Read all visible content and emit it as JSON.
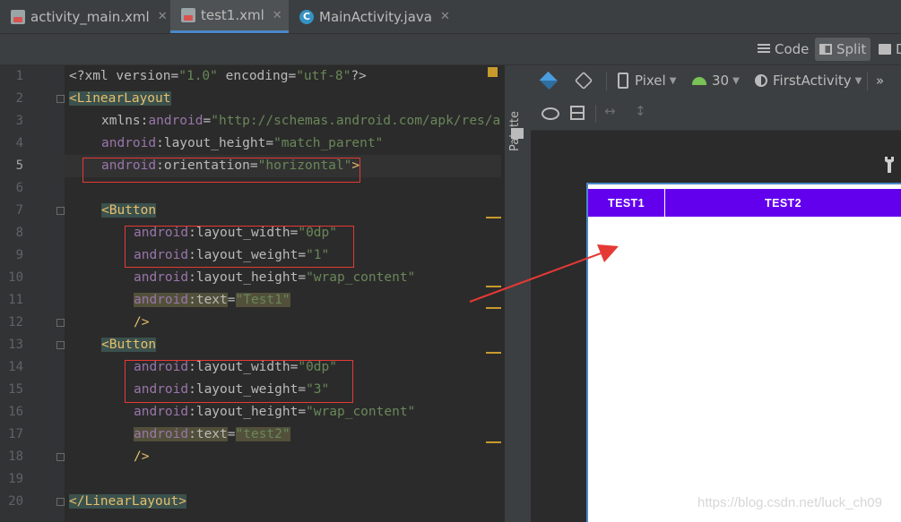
{
  "tabs": [
    {
      "label": "activity_main.xml",
      "icon": "xml-file-icon",
      "active": false
    },
    {
      "label": "test1.xml",
      "icon": "xml-file-icon",
      "active": true
    },
    {
      "label": "MainActivity.java",
      "icon": "java-class-icon",
      "active": false
    }
  ],
  "java_icon_letter": "C",
  "view_modes": {
    "code": "Code",
    "split": "Split",
    "design": "D"
  },
  "palette_label": "Palette",
  "line_numbers": [
    "1",
    "2",
    "3",
    "4",
    "5",
    "6",
    "7",
    "8",
    "9",
    "10",
    "11",
    "12",
    "13",
    "14",
    "15",
    "16",
    "17",
    "18",
    "19",
    "20"
  ],
  "code": {
    "l1": {
      "pi": "<?xml ",
      "a1": "version",
      "eq1": "=",
      "v1": "\"1.0\"",
      "sp": " ",
      "a2": "encoding",
      "eq2": "=",
      "v2": "\"utf-8\"",
      "end": "?>"
    },
    "l2": {
      "tag": "<LinearLayout"
    },
    "l3": {
      "ns": "xmlns:",
      "attr": "android",
      "eq": "=",
      "val": "\"http://schemas.android.com/apk/res/android\""
    },
    "l4": {
      "ns": "android",
      "attr": ":layout_height",
      "eq": "=",
      "val": "\"match_parent\""
    },
    "l5": {
      "ns": "android",
      "attr": ":orientation",
      "eq": "=",
      "val": "\"horizontal\"",
      "end": ">"
    },
    "l7": {
      "tag": "<Button"
    },
    "l8": {
      "ns": "android",
      "attr": ":layout_width",
      "eq": "=",
      "val": "\"0dp\""
    },
    "l9": {
      "ns": "android",
      "attr": ":layout_weight",
      "eq": "=",
      "val": "\"1\""
    },
    "l10": {
      "ns": "android",
      "attr": ":layout_height",
      "eq": "=",
      "val": "\"wrap_content\""
    },
    "l11": {
      "ns": "android",
      "attr": ":text",
      "eq": "=",
      "val": "\"Test1\""
    },
    "l12": {
      "end": "/>"
    },
    "l13": {
      "tag": "<Button"
    },
    "l14": {
      "ns": "android",
      "attr": ":layout_width",
      "eq": "=",
      "val": "\"0dp\""
    },
    "l15": {
      "ns": "android",
      "attr": ":layout_weight",
      "eq": "=",
      "val": "\"3\""
    },
    "l16": {
      "ns": "android",
      "attr": ":layout_height",
      "eq": "=",
      "val": "\"wrap_content\""
    },
    "l17": {
      "ns": "android",
      "attr": ":text",
      "eq": "=",
      "val": "\"test2\""
    },
    "l18": {
      "end": "/>"
    },
    "l20": {
      "tag": "</LinearLayout>"
    }
  },
  "design_toolbar": {
    "device": "Pixel",
    "api": "30",
    "theme": "FirstActivity",
    "overflow": "»"
  },
  "preview": {
    "button1": "TEST1",
    "button2": "TEST2",
    "weight1": 1,
    "weight2": 3,
    "button_color": "#6200ee"
  },
  "watermark": "https://blog.csdn.net/luck_ch09",
  "colors": {
    "annotation_red": "#e53935",
    "tag": "#e8bf6a",
    "namespace": "#9876aa",
    "string": "#6a8759"
  }
}
